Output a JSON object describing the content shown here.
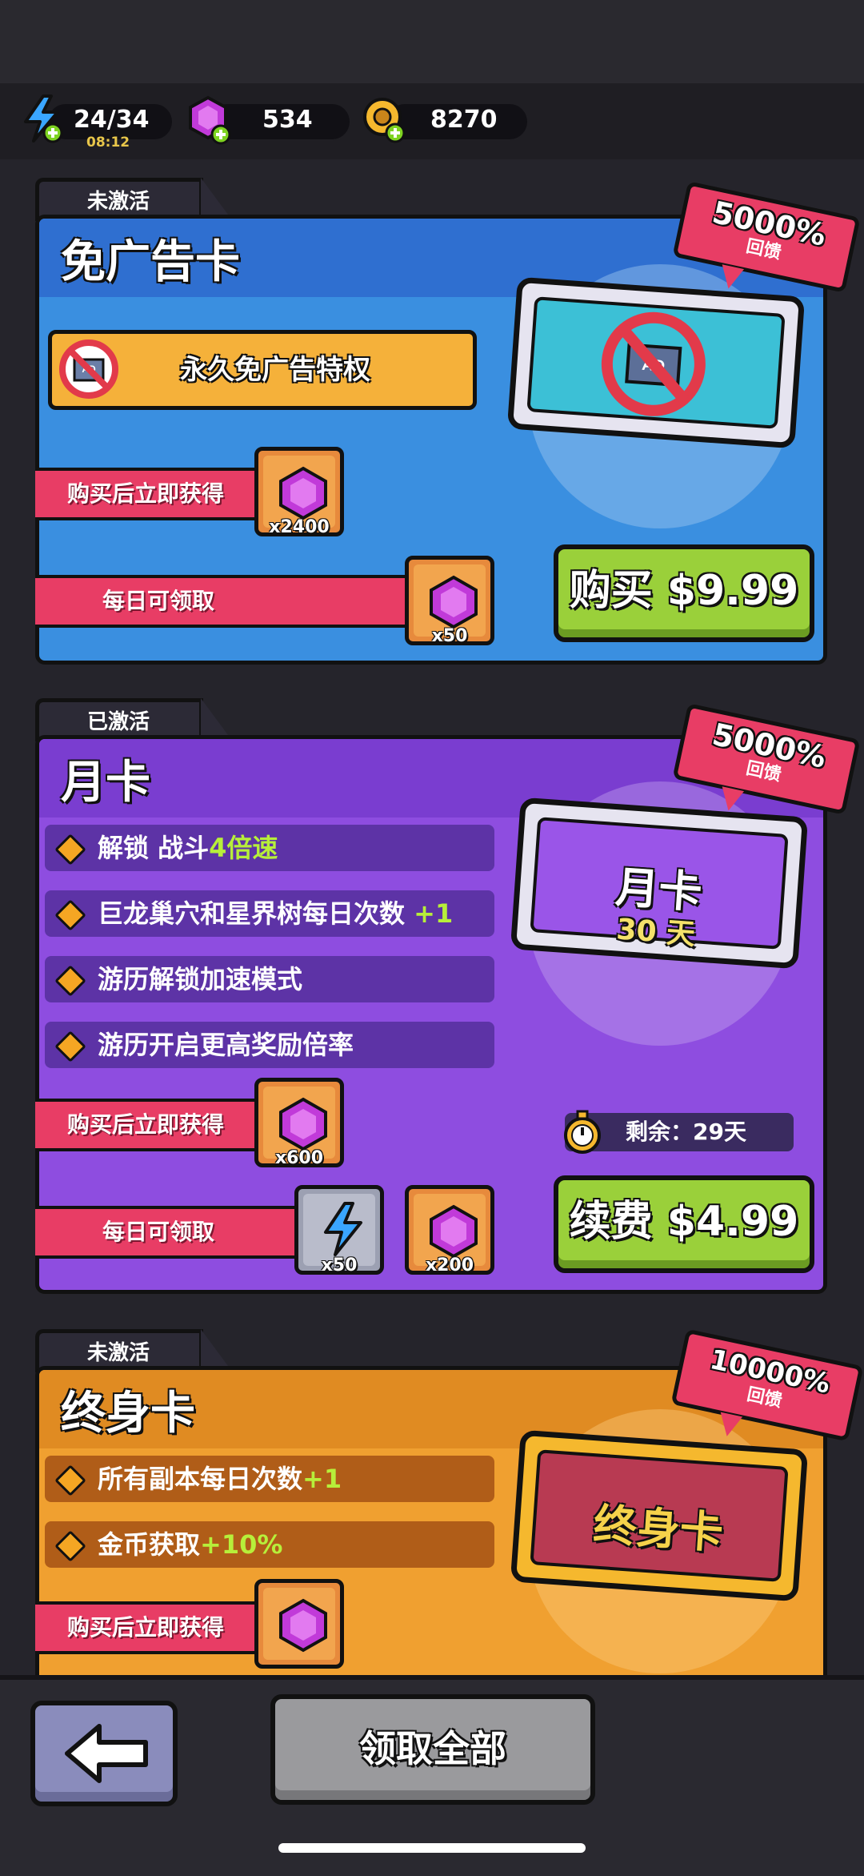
{
  "resources": {
    "energy": {
      "value": "24/34",
      "timer": "08:12"
    },
    "gems": {
      "value": "534"
    },
    "coins": {
      "value": "8270"
    }
  },
  "cards": [
    {
      "status": "未激活",
      "title": "免广告卡",
      "privilege": "永久免广告特权",
      "instant_label": "购买后立即获得",
      "instant_qty": "x2400",
      "daily_label": "每日可领取",
      "daily_qty": "x50",
      "badge_value": "5000%",
      "badge_text": "回馈",
      "button": "购买 $9.99"
    },
    {
      "status": "已激活",
      "title": "月卡",
      "features": [
        {
          "text": "解锁 战斗",
          "highlight": "4倍速"
        },
        {
          "text": "巨龙巢穴和星界树每日次数 ",
          "highlight": "+1"
        },
        {
          "text": "游历解锁加速模式",
          "highlight": ""
        },
        {
          "text": "游历开启更高奖励倍率",
          "highlight": ""
        }
      ],
      "instant_label": "购买后立即获得",
      "instant_qty": "x600",
      "daily_label": "每日可领取",
      "daily_qty_energy": "x50",
      "daily_qty_gems": "x200",
      "badge_value": "5000%",
      "badge_text": "回馈",
      "ticket_title": "月卡",
      "ticket_days": "30 天",
      "remaining": "剩余：29天",
      "button": "续费 $4.99"
    },
    {
      "status": "未激活",
      "title": "终身卡",
      "features": [
        {
          "text": "所有副本每日次数",
          "highlight": "+1"
        },
        {
          "text": "金币获取",
          "highlight": "+10%"
        }
      ],
      "instant_label": "购买后立即获得",
      "badge_value": "10000%",
      "badge_text": "回馈",
      "ticket_title": "终身卡"
    }
  ],
  "bottom": {
    "claim_all": "领取全部"
  },
  "colors": {
    "ad_card": "#3a8fe0",
    "monthly_card": "#8e4de0",
    "lifetime_card": "#f0a030",
    "buy_button": "#9ad03a",
    "label_pink": "#e83d65"
  }
}
